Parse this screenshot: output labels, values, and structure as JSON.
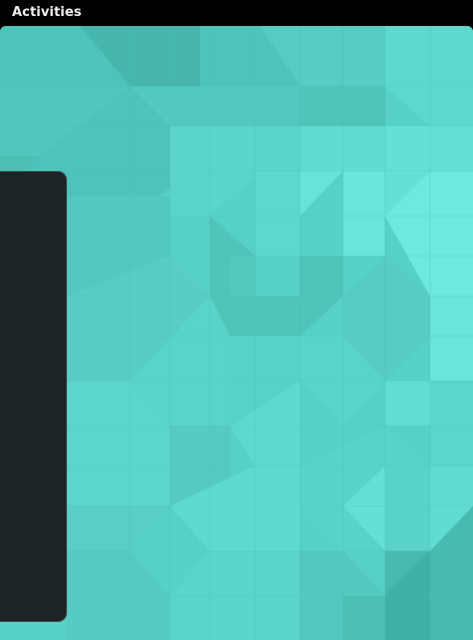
{
  "top_bar": {
    "activities_label": "Activities"
  },
  "dash": {
    "items": [
      {
        "icon": "web-browser-globe-icon",
        "running": true
      },
      {
        "icon": "terminal-icon",
        "running": true
      },
      {
        "icon": "rhythmbox-speaker-icon",
        "running": false
      },
      {
        "icon": "file-cabinet-icon",
        "running": true
      },
      {
        "icon": "text-editor-notepad-icon",
        "running": true
      },
      {
        "icon": "calculator-icon",
        "running": true
      }
    ],
    "show_apps_icon": "app-grid-icon"
  },
  "colors": {
    "top_bar": "#000000",
    "wallpaper_base": "#58d2c8",
    "dash_background": "#1c2426",
    "running_indicator": "#c9e2e6"
  }
}
